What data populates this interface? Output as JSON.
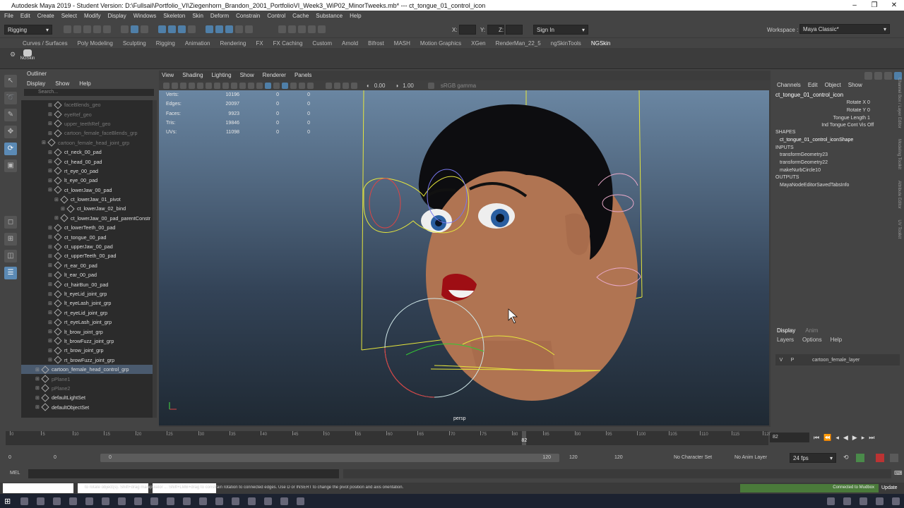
{
  "title": "Autodesk Maya 2019 - Student Version: D:\\Fullsail\\Portfolio_VI\\Ziegenhorn_Brandon_2001_PortfolioVI_Week3_WiP02_MinorTweeks.mb* --- ct_tongue_01_control_icon",
  "window_controls": [
    "–",
    "❐",
    "✕"
  ],
  "menu": [
    "File",
    "Edit",
    "Create",
    "Select",
    "Modify",
    "Display",
    "Windows",
    "Skeleton",
    "Skin",
    "Deform",
    "Constrain",
    "Control",
    "Cache",
    "Substance",
    "Help"
  ],
  "status": {
    "menuset": "Rigging",
    "x_label": "X:",
    "y_label": "Y:",
    "z_label": "Z:",
    "signin": "Sign In",
    "workspace_label": "Workspace :",
    "workspace": "Maya Classic*"
  },
  "shelf_tabs": [
    "Curves / Surfaces",
    "Poly Modeling",
    "Sculpting",
    "Rigging",
    "Animation",
    "Rendering",
    "FX",
    "FX Caching",
    "Custom",
    "Arnold",
    "Bifrost",
    "MASH",
    "Motion Graphics",
    "XGen",
    "RenderMan_22_5",
    "ngSkinTools",
    "NGSkin"
  ],
  "shelf_active": "NGSkin",
  "shelf_button": "NGSkin",
  "outliner": {
    "title": "Outliner",
    "menu": [
      "Display",
      "Show",
      "Help"
    ],
    "search_placeholder": "Search...",
    "items": [
      {
        "label": "faceBlends_geo",
        "indent": 2,
        "grey": true
      },
      {
        "label": "eyeRef_geo",
        "indent": 2,
        "grey": true
      },
      {
        "label": "upper_teethRef_geo",
        "indent": 2,
        "grey": true
      },
      {
        "label": "cartoon_female_faceBlends_grp",
        "indent": 2,
        "grey": true
      },
      {
        "label": "cartoon_female_head_joint_grp",
        "indent": 1,
        "grey": true
      },
      {
        "label": "ct_neck_00_pad",
        "indent": 2
      },
      {
        "label": "ct_head_00_pad",
        "indent": 2
      },
      {
        "label": "rt_eye_00_pad",
        "indent": 2
      },
      {
        "label": "lt_eye_00_pad",
        "indent": 2
      },
      {
        "label": "ct_lowerJaw_00_pad",
        "indent": 2
      },
      {
        "label": "ct_lowerJaw_01_pivot",
        "indent": 3
      },
      {
        "label": "ct_lowerJaw_02_bind",
        "indent": 4
      },
      {
        "label": "ct_lowerJaw_00_pad_parentConstr",
        "indent": 3
      },
      {
        "label": "ct_lowerTeeth_00_pad",
        "indent": 2
      },
      {
        "label": "ct_tongue_00_pad",
        "indent": 2
      },
      {
        "label": "ct_upperJaw_00_pad",
        "indent": 2
      },
      {
        "label": "ct_upperTeeth_00_pad",
        "indent": 2
      },
      {
        "label": "rt_ear_00_pad",
        "indent": 2
      },
      {
        "label": "lt_ear_00_pad",
        "indent": 2
      },
      {
        "label": "ct_hairBun_00_pad",
        "indent": 2
      },
      {
        "label": "lt_eyeLid_joint_grp",
        "indent": 2
      },
      {
        "label": "lt_eyeLash_joint_grp",
        "indent": 2
      },
      {
        "label": "rt_eyeLid_joint_grp",
        "indent": 2
      },
      {
        "label": "rt_eyeLash_joint_grp",
        "indent": 2
      },
      {
        "label": "lt_brow_joint_grp",
        "indent": 2
      },
      {
        "label": "lt_browFuzz_joint_grp",
        "indent": 2
      },
      {
        "label": "rt_brow_joint_grp",
        "indent": 2
      },
      {
        "label": "rt_browFuzz_joint_grp",
        "indent": 2
      },
      {
        "label": "cartoon_female_head_control_grp",
        "indent": 0,
        "selected": true
      },
      {
        "label": "pPlane1",
        "indent": 0,
        "grey": true
      },
      {
        "label": "pPlane2",
        "indent": 0,
        "grey": true
      },
      {
        "label": "defaultLightSet",
        "indent": 0
      },
      {
        "label": "defaultObjectSet",
        "indent": 0
      }
    ]
  },
  "viewport": {
    "menu": [
      "View",
      "Shading",
      "Lighting",
      "Show",
      "Renderer",
      "Panels"
    ],
    "field1": "0.00",
    "field2": "1.00",
    "colorspace": "sRGB gamma",
    "camera": "persp",
    "hud": [
      {
        "label": "Verts:",
        "a": "10196",
        "b": "0",
        "c": "0"
      },
      {
        "label": "Edges:",
        "a": "20097",
        "b": "0",
        "c": "0"
      },
      {
        "label": "Faces:",
        "a": "9923",
        "b": "0",
        "c": "0"
      },
      {
        "label": "Tris:",
        "a": "19846",
        "b": "0",
        "c": "0"
      },
      {
        "label": "UVs:",
        "a": "11098",
        "b": "0",
        "c": "0"
      }
    ]
  },
  "channel_box": {
    "menu": [
      "Channels",
      "Edit",
      "Object",
      "Show"
    ],
    "object": "ct_tongue_01_control_icon",
    "attrs": [
      {
        "label": "Rotate X",
        "value": "0"
      },
      {
        "label": "Rotate Y",
        "value": "0"
      },
      {
        "label": "Tongue Length",
        "value": "1"
      },
      {
        "label": "Ind Tongue Cont Vis",
        "value": "Off"
      }
    ],
    "shapes_label": "SHAPES",
    "shape": "ct_tongue_01_control_iconShape",
    "inputs_label": "INPUTS",
    "inputs": [
      "transformGeometry23",
      "transformGeometry22",
      "makeNurbCircle10"
    ],
    "outputs_label": "OUTPUTS",
    "outputs": [
      "MayaNodeEditorSavedTabsInfo"
    ],
    "side_tabs": [
      "Channel Box / Layer Editor",
      "Modeling Toolkit",
      "Attribute Editor",
      "UV Toolkit"
    ]
  },
  "layers": {
    "tabs": [
      "Display",
      "Anim"
    ],
    "menu": [
      "Layers",
      "Options",
      "Help"
    ],
    "row": {
      "v": "V",
      "p": "P",
      "name": "cartoon_female_layer"
    }
  },
  "timeline": {
    "ticks": [
      "0",
      "5",
      "10",
      "15",
      "20",
      "25",
      "30",
      "35",
      "40",
      "45",
      "50",
      "55",
      "60",
      "65",
      "70",
      "75",
      "80",
      "85",
      "90",
      "95",
      "100",
      "105",
      "110",
      "115",
      "120"
    ],
    "current": "82",
    "frame_field": "82",
    "range_start": "0",
    "range_inner_start": "0",
    "range_handle_start": "0",
    "range_handle_end": "120",
    "range_end": "120",
    "anim_end": "120",
    "char_set": "No Character Set",
    "anim_layer": "No Anim Layer",
    "fps": "24 fps"
  },
  "command": {
    "mel": "MEL"
  },
  "help_line": "to rotate object(s). Shift+drag manipulator ... Shift+LMB+drag to constrain rotation to connected edges. Use D or INSERT to change the pivot position and axis orientation.",
  "mudbox": "Connected to Mudbox",
  "update": "Update"
}
